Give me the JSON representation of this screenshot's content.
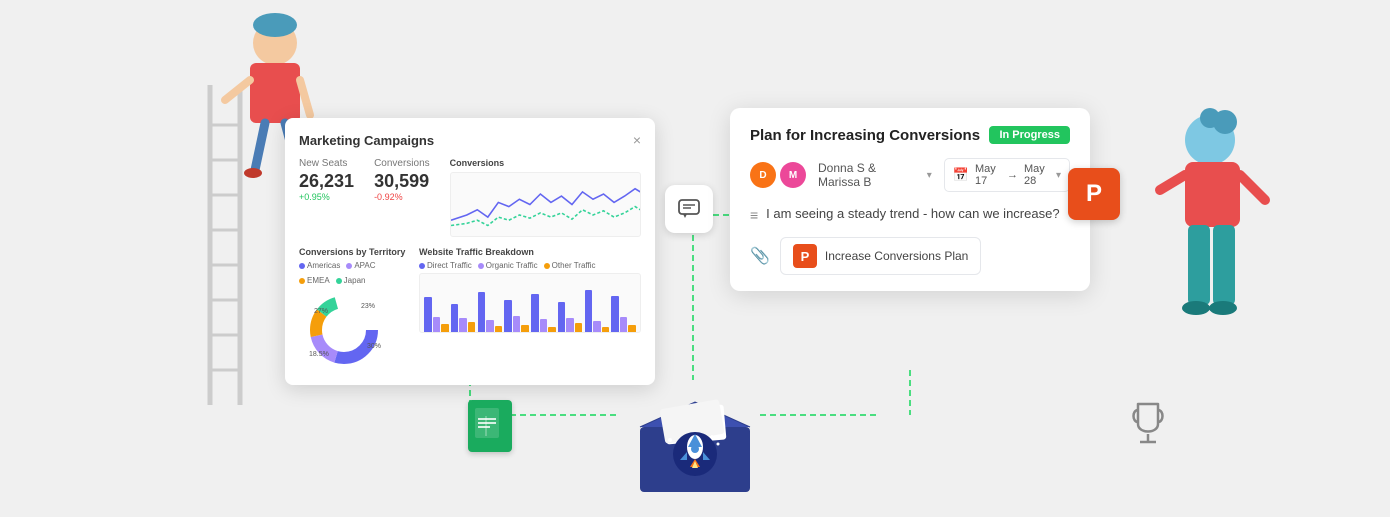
{
  "scene": {
    "background_color": "#eeeeee"
  },
  "marketing_card": {
    "title": "Marketing Campaigns",
    "close_label": "×",
    "metrics": {
      "new_seats": {
        "label": "New Seats",
        "value": "26,231",
        "change": "+0.95%",
        "change_type": "positive"
      },
      "conversions": {
        "label": "Conversions",
        "value": "30,599",
        "change": "-0.92%",
        "change_type": "negative"
      }
    },
    "conversions_chart_title": "Conversions",
    "territory_chart_title": "Conversions by Territory",
    "traffic_chart_title": "Website Traffic Breakdown",
    "territory_legend": [
      {
        "label": "Americas",
        "color": "#6366f1"
      },
      {
        "label": "APAC",
        "color": "#a78bfa"
      },
      {
        "label": "EMEA",
        "color": "#f59e0b"
      },
      {
        "label": "Japan",
        "color": "#34d399"
      }
    ],
    "traffic_legend": [
      {
        "label": "Direct Traffic",
        "color": "#6366f1"
      },
      {
        "label": "Organic Traffic",
        "color": "#a78bfa"
      },
      {
        "label": "Other Traffic",
        "color": "#f59e0b"
      }
    ]
  },
  "task_card": {
    "title": "Plan for Increasing Conversions",
    "status": "In Progress",
    "assignees": {
      "donna": "Donna S",
      "marissa": "Marissa B"
    },
    "date_range": {
      "start": "May 17",
      "arrow": "→",
      "end": "May 28"
    },
    "description": "I am seeing a steady trend - how can we increase?",
    "attachment_label": "Increase Conversions Plan"
  },
  "icons": {
    "chat": "💬",
    "calendar": "📅",
    "clip": "📎",
    "sheets_letter": "S",
    "trophy": "🏆",
    "ppt_letter": "P"
  }
}
